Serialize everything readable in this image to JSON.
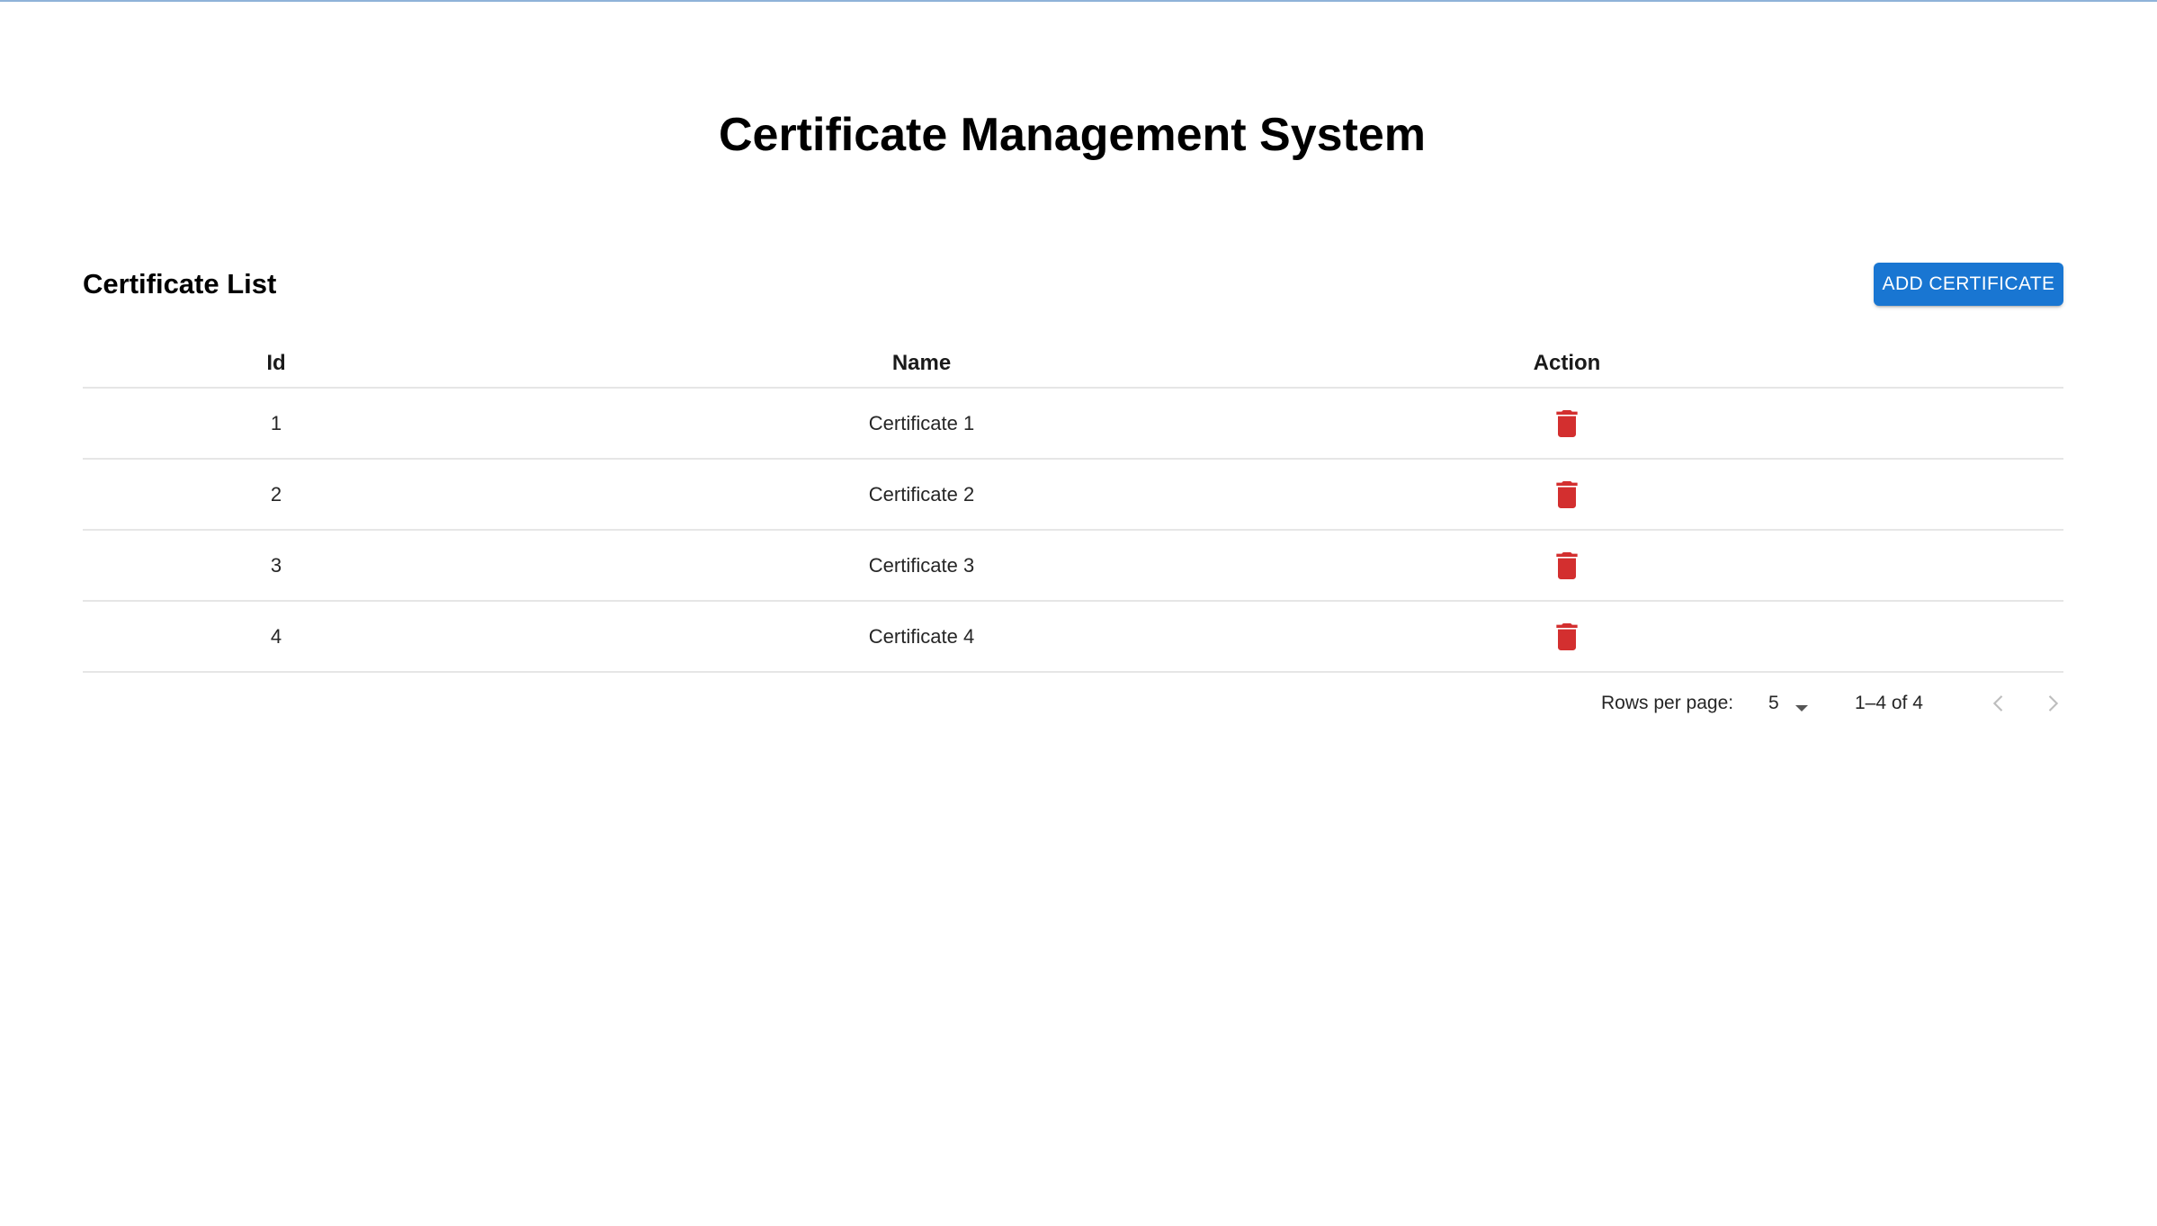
{
  "app": {
    "title": "Certificate Management System"
  },
  "list": {
    "title": "Certificate List",
    "add_button_label": "ADD CERTIFICATE"
  },
  "table": {
    "headers": {
      "id": "Id",
      "name": "Name",
      "action": "Action"
    },
    "rows": [
      {
        "id": "1",
        "name": "Certificate 1",
        "action_icon": "delete-icon"
      },
      {
        "id": "2",
        "name": "Certificate 2",
        "action_icon": "delete-icon"
      },
      {
        "id": "3",
        "name": "Certificate 3",
        "action_icon": "delete-icon"
      },
      {
        "id": "4",
        "name": "Certificate 4",
        "action_icon": "delete-icon"
      }
    ]
  },
  "pagination": {
    "rows_per_page_label": "Rows per page:",
    "rows_per_page_value": "5",
    "range": "1–4 of 4",
    "prev_icon": "chevron-left-icon",
    "next_icon": "chevron-right-icon"
  },
  "colors": {
    "primary": "#1976d2",
    "danger": "#d32f2f",
    "divider": "#e6e6e6",
    "disabled": "#bdbdbd"
  }
}
